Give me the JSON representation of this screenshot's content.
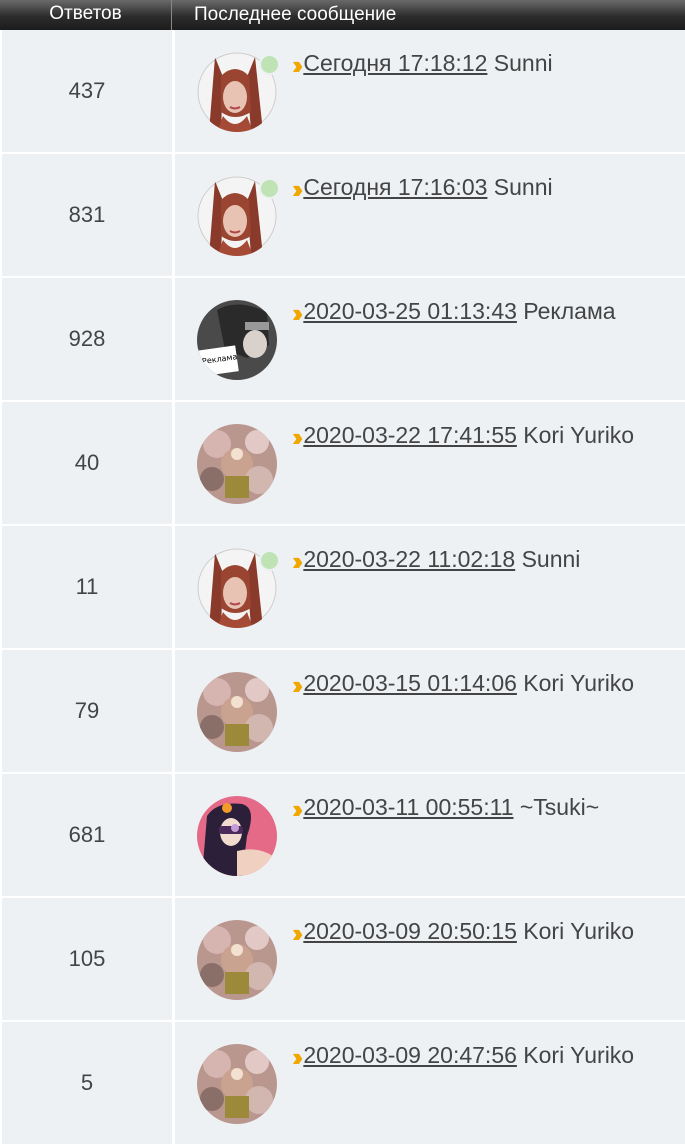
{
  "header": {
    "replies": "Ответов",
    "last_post": "Последнее сообщение"
  },
  "rows": [
    {
      "replies": "437",
      "date": "Сегодня 17:18:12",
      "author": "Sunni",
      "avatar": "girl-red-hair",
      "online": true
    },
    {
      "replies": "831",
      "date": "Сегодня 17:16:03",
      "author": "Sunni",
      "avatar": "girl-red-hair",
      "online": true
    },
    {
      "replies": "928",
      "date": "2020-03-25 01:13:43",
      "author": "Реклама",
      "avatar": "ninja-sign",
      "online": false,
      "avatar_text": "Реклама"
    },
    {
      "replies": "40",
      "date": "2020-03-22 17:41:55",
      "author": "Kori Yuriko",
      "avatar": "floral",
      "online": false
    },
    {
      "replies": "11",
      "date": "2020-03-22 11:02:18",
      "author": "Sunni",
      "avatar": "girl-red-hair",
      "online": true
    },
    {
      "replies": "79",
      "date": "2020-03-15 01:14:06",
      "author": "Kori Yuriko",
      "avatar": "floral",
      "online": false
    },
    {
      "replies": "681",
      "date": "2020-03-11 00:55:11",
      "author": "~Tsuki~",
      "avatar": "girl-pink",
      "online": false
    },
    {
      "replies": "105",
      "date": "2020-03-09 20:50:15",
      "author": "Kori Yuriko",
      "avatar": "floral",
      "online": false
    },
    {
      "replies": "5",
      "date": "2020-03-09 20:47:56",
      "author": "Kori Yuriko",
      "avatar": "floral",
      "online": false
    }
  ],
  "colors": {
    "header_top": "#6a6a6a",
    "header_bottom": "#1c1c1c",
    "row_bg": "#edf1f4",
    "arrow": "#f0a800",
    "online": "#bfe3b4"
  }
}
